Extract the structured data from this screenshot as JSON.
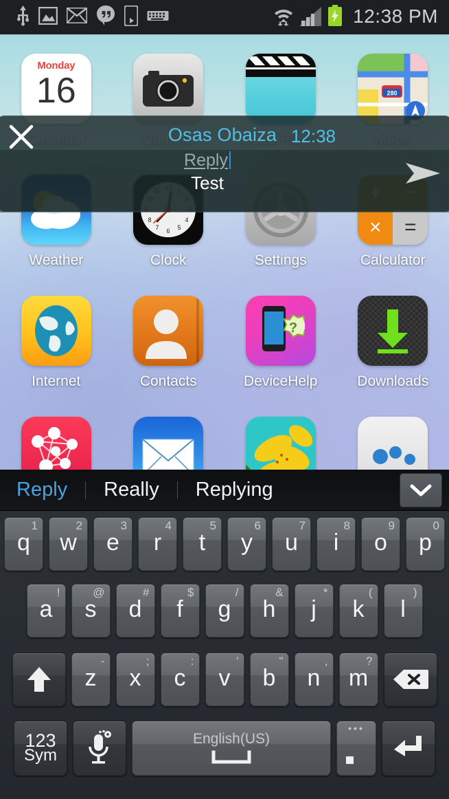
{
  "status_bar": {
    "time": "12:38 PM",
    "left_icons": [
      "usb-icon",
      "screenshot-image-icon",
      "mail-icon",
      "hangouts-icon",
      "device-player-icon",
      "keyboard-icon"
    ],
    "right_icons": [
      "wifi-icon",
      "signal-icon",
      "battery-charging-icon"
    ],
    "colors": {
      "background": "#1c2023",
      "text": "#cfd2d4",
      "battery": "#99d62c"
    }
  },
  "home_screen": {
    "rows": [
      {
        "apps": [
          {
            "label": "Calendar",
            "icon": "calendar-icon",
            "day_of_week": "Monday",
            "day_number": "16"
          },
          {
            "label": "Camera",
            "icon": "camera-icon"
          },
          {
            "label": "Video Player",
            "icon": "video-player-icon"
          },
          {
            "label": "Maps",
            "icon": "maps-icon",
            "route_badge": "280"
          }
        ]
      },
      {
        "apps": [
          {
            "label": "Weather",
            "icon": "weather-icon"
          },
          {
            "label": "Clock",
            "icon": "clock-icon"
          },
          {
            "label": "Settings",
            "icon": "settings-icon"
          },
          {
            "label": "Calculator",
            "icon": "calculator-icon",
            "keys": [
              "+",
              "−",
              "×",
              "="
            ]
          }
        ]
      },
      {
        "apps": [
          {
            "label": "Internet",
            "icon": "internet-globe-icon"
          },
          {
            "label": "Contacts",
            "icon": "contacts-icon"
          },
          {
            "label": "DeviceHelp",
            "icon": "device-help-icon"
          },
          {
            "label": "Downloads",
            "icon": "downloads-icon"
          }
        ]
      },
      {
        "apps": [
          {
            "label": "",
            "icon": "game-center-icon"
          },
          {
            "label": "",
            "icon": "email-icon"
          },
          {
            "label": "",
            "icon": "gallery-icon"
          },
          {
            "label": "",
            "icon": "people-group-icon"
          }
        ]
      }
    ]
  },
  "notification": {
    "sender": "Osas Obaiza",
    "time": "12:38",
    "reply_placeholder": "Reply",
    "reply_value": "Test",
    "close_icon": "close-x-icon",
    "send_icon": "send-arrow-icon",
    "accent_color": "#4fc0e8"
  },
  "keyboard": {
    "suggestions": [
      {
        "text": "Reply",
        "selected": true
      },
      {
        "text": "Really",
        "selected": false
      },
      {
        "text": "Replying",
        "selected": false
      }
    ],
    "expand_icon": "chevron-down-icon",
    "rows": [
      {
        "keys": [
          {
            "main": "q",
            "alt": "1"
          },
          {
            "main": "w",
            "alt": "2"
          },
          {
            "main": "e",
            "alt": "3"
          },
          {
            "main": "r",
            "alt": "4"
          },
          {
            "main": "t",
            "alt": "5"
          },
          {
            "main": "y",
            "alt": "6"
          },
          {
            "main": "u",
            "alt": "7"
          },
          {
            "main": "i",
            "alt": "8"
          },
          {
            "main": "o",
            "alt": "9"
          },
          {
            "main": "p",
            "alt": "0"
          }
        ]
      },
      {
        "keys": [
          {
            "main": "a",
            "alt": "!"
          },
          {
            "main": "s",
            "alt": "@"
          },
          {
            "main": "d",
            "alt": "#"
          },
          {
            "main": "f",
            "alt": "$"
          },
          {
            "main": "g",
            "alt": "/"
          },
          {
            "main": "h",
            "alt": "&"
          },
          {
            "main": "j",
            "alt": "*"
          },
          {
            "main": "k",
            "alt": "("
          },
          {
            "main": "l",
            "alt": ")"
          }
        ]
      },
      {
        "keys": [
          {
            "main": "z",
            "alt": "-"
          },
          {
            "main": "x",
            "alt": ";"
          },
          {
            "main": "c",
            "alt": ":"
          },
          {
            "main": "v",
            "alt": "'"
          },
          {
            "main": "b",
            "alt": "\""
          },
          {
            "main": "n",
            "alt": ","
          },
          {
            "main": "m",
            "alt": "?"
          }
        ],
        "shift_icon": "shift-arrow-icon",
        "backspace_icon": "backspace-icon"
      }
    ],
    "bottom_row": {
      "symbols_line1": "123",
      "symbols_line2": "Sym",
      "mic_icon": "microphone-settings-icon",
      "space_label": "English(US)",
      "space_icon": "spacebar-icon",
      "period_key": ".",
      "period_alt": "•••",
      "enter_icon": "enter-return-icon"
    }
  }
}
